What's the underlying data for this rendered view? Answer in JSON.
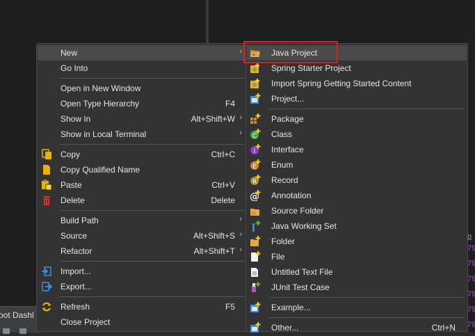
{
  "background": {
    "bottom_tab_label": "oot Dashl",
    "right_marks": [
      "79",
      "79",
      "79",
      "79",
      "79",
      "79",
      "79"
    ]
  },
  "context_menu": {
    "items": {
      "new": {
        "label": "New"
      },
      "go_into": {
        "label": "Go Into"
      },
      "open_new_window": {
        "label": "Open in New Window"
      },
      "open_type_hierarchy": {
        "label": "Open Type Hierarchy",
        "shortcut": "F4"
      },
      "show_in": {
        "label": "Show In",
        "shortcut": "Alt+Shift+W"
      },
      "show_local_terminal": {
        "label": "Show in Local Terminal"
      },
      "copy": {
        "label": "Copy",
        "shortcut": "Ctrl+C"
      },
      "copy_qualified_name": {
        "label": "Copy Qualified Name"
      },
      "paste": {
        "label": "Paste",
        "shortcut": "Ctrl+V"
      },
      "delete": {
        "label": "Delete",
        "shortcut": "Delete"
      },
      "build_path": {
        "label": "Build Path"
      },
      "source": {
        "label": "Source",
        "shortcut": "Alt+Shift+S"
      },
      "refactor": {
        "label": "Refactor",
        "shortcut": "Alt+Shift+T"
      },
      "import": {
        "label": "Import..."
      },
      "export": {
        "label": "Export..."
      },
      "refresh": {
        "label": "Refresh",
        "shortcut": "F5"
      },
      "close_project": {
        "label": "Close Project"
      }
    }
  },
  "submenu": {
    "items": {
      "java_project": {
        "label": "Java Project"
      },
      "spring_starter": {
        "label": "Spring Starter Project"
      },
      "import_spring": {
        "label": "Import Spring Getting Started Content"
      },
      "project": {
        "label": "Project..."
      },
      "package": {
        "label": "Package"
      },
      "class": {
        "label": "Class"
      },
      "interface": {
        "label": "Interface"
      },
      "enum": {
        "label": "Enum"
      },
      "record": {
        "label": "Record"
      },
      "annotation": {
        "label": "Annotation"
      },
      "source_folder": {
        "label": "Source Folder"
      },
      "java_working_set": {
        "label": "Java Working Set"
      },
      "folder": {
        "label": "Folder"
      },
      "file": {
        "label": "File"
      },
      "untitled_text_file": {
        "label": "Untitled Text File"
      },
      "junit_test_case": {
        "label": "JUnit Test Case"
      },
      "example": {
        "label": "Example..."
      },
      "other": {
        "label": "Other...",
        "shortcut": "Ctrl+N"
      }
    }
  },
  "arrow_glyph": "›",
  "colors": {
    "menu_bg": "#333333",
    "highlight_bg": "#4a4a4a",
    "highlight_box": "#e01e1e",
    "text": "#e6e6e6"
  }
}
